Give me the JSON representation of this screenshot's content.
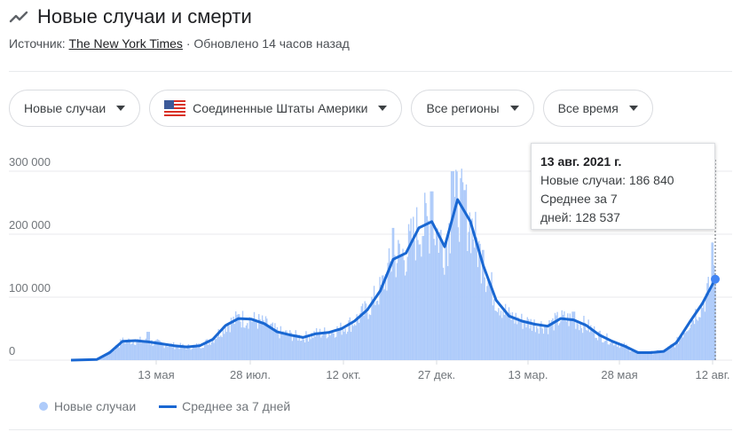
{
  "header": {
    "title": "Новые случаи и смерти",
    "icon": "trending-icon"
  },
  "source": {
    "prefix": "Источник:",
    "link": "The New York Times",
    "updated": "· Обновлено 14 часов назад"
  },
  "filters": [
    {
      "label": "Новые случаи"
    },
    {
      "label": "Соединенные Штаты Америки",
      "icon": "us-flag-icon"
    },
    {
      "label": "Все регионы"
    },
    {
      "label": "Все время"
    }
  ],
  "tooltip": {
    "date": "13 авг. 2021 г.",
    "line1": "Новые случаи: 186 840",
    "line2": "Среднее за 7",
    "line3": "дней: 128 537"
  },
  "legend": {
    "cases": "Новые случаи",
    "avg": "Среднее за 7 дней"
  },
  "colors": {
    "bars": "#aecbfa",
    "line": "#1967d2",
    "grid": "#e8eaed"
  },
  "chart_data": {
    "type": "area",
    "y_ticks": [
      {
        "value": 0,
        "label": "0"
      },
      {
        "value": 100000,
        "label": "100 000"
      },
      {
        "value": 200000,
        "label": "200 000"
      },
      {
        "value": 300000,
        "label": "300 000"
      }
    ],
    "ylim": [
      0,
      320000
    ],
    "x_ticks": [
      "13 мая",
      "28 июл.",
      "12 окт.",
      "27 дек.",
      "13 мар.",
      "28 мая",
      "12 авг."
    ],
    "series": [
      {
        "name": "Среднее за 7 дней",
        "points": [
          [
            0,
            0
          ],
          [
            1,
            1000
          ],
          [
            1.5,
            12000
          ],
          [
            2,
            30000
          ],
          [
            2.5,
            31000
          ],
          [
            3,
            29000
          ],
          [
            3.5,
            26000
          ],
          [
            4,
            23000
          ],
          [
            4.5,
            21000
          ],
          [
            5,
            23000
          ],
          [
            5.5,
            33000
          ],
          [
            6,
            55000
          ],
          [
            6.5,
            66000
          ],
          [
            7,
            65000
          ],
          [
            7.5,
            58000
          ],
          [
            8,
            45000
          ],
          [
            8.5,
            40000
          ],
          [
            9,
            36000
          ],
          [
            9.5,
            42000
          ],
          [
            10,
            44000
          ],
          [
            10.5,
            50000
          ],
          [
            11,
            62000
          ],
          [
            11.5,
            80000
          ],
          [
            12,
            110000
          ],
          [
            12.5,
            160000
          ],
          [
            13,
            170000
          ],
          [
            13.5,
            210000
          ],
          [
            14,
            220000
          ],
          [
            14.5,
            180000
          ],
          [
            15,
            255000
          ],
          [
            15.5,
            220000
          ],
          [
            16,
            150000
          ],
          [
            16.5,
            95000
          ],
          [
            17,
            70000
          ],
          [
            17.5,
            62000
          ],
          [
            18,
            57000
          ],
          [
            18.5,
            54000
          ],
          [
            19,
            66000
          ],
          [
            19.5,
            64000
          ],
          [
            20,
            55000
          ],
          [
            20.5,
            40000
          ],
          [
            21,
            30000
          ],
          [
            21.5,
            22000
          ],
          [
            22,
            12000
          ],
          [
            22.5,
            12000
          ],
          [
            23,
            14000
          ],
          [
            23.5,
            28000
          ],
          [
            24,
            60000
          ],
          [
            24.5,
            90000
          ],
          [
            25,
            128537
          ]
        ]
      },
      {
        "name": "Новые случаи",
        "note_spikes": [
          [
            3,
            45000
          ],
          [
            6.5,
            73000
          ],
          [
            12.5,
            210000
          ],
          [
            14,
            268000
          ],
          [
            14.8,
            300000
          ],
          [
            15.3,
            270000
          ],
          [
            16,
            175000
          ],
          [
            19.5,
            77000
          ],
          [
            24.9,
            186840
          ]
        ]
      }
    ]
  }
}
